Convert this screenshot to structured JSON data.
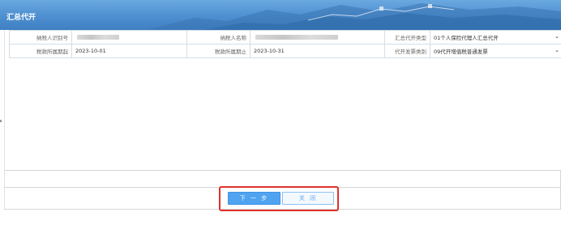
{
  "window": {
    "title": "汇总代开"
  },
  "form": {
    "row1": {
      "taxpayer_id_label": "纳税人识别号",
      "taxpayer_name_label": "纳税人名称",
      "summary_type_label": "汇总代开类型",
      "summary_type_value": "01个人保险代理人汇总代开"
    },
    "row2": {
      "period_start_label": "税款所属期起",
      "period_start_value": "2023-10-01",
      "period_end_label": "税款所属期止",
      "period_end_value": "2023-10-31",
      "invoice_type_label": "代开发票类别",
      "invoice_type_value": "09代开增值税普通发票"
    }
  },
  "buttons": {
    "next": "下 一 步",
    "close": "关 闭"
  },
  "colors": {
    "title_bar": "#4d8fd0",
    "primary_button": "#4fa3f0",
    "secondary_button_text": "#5aa6ee",
    "highlight_box": "#e0312b"
  },
  "icons": {
    "dropdown": "chevron-down-icon"
  }
}
